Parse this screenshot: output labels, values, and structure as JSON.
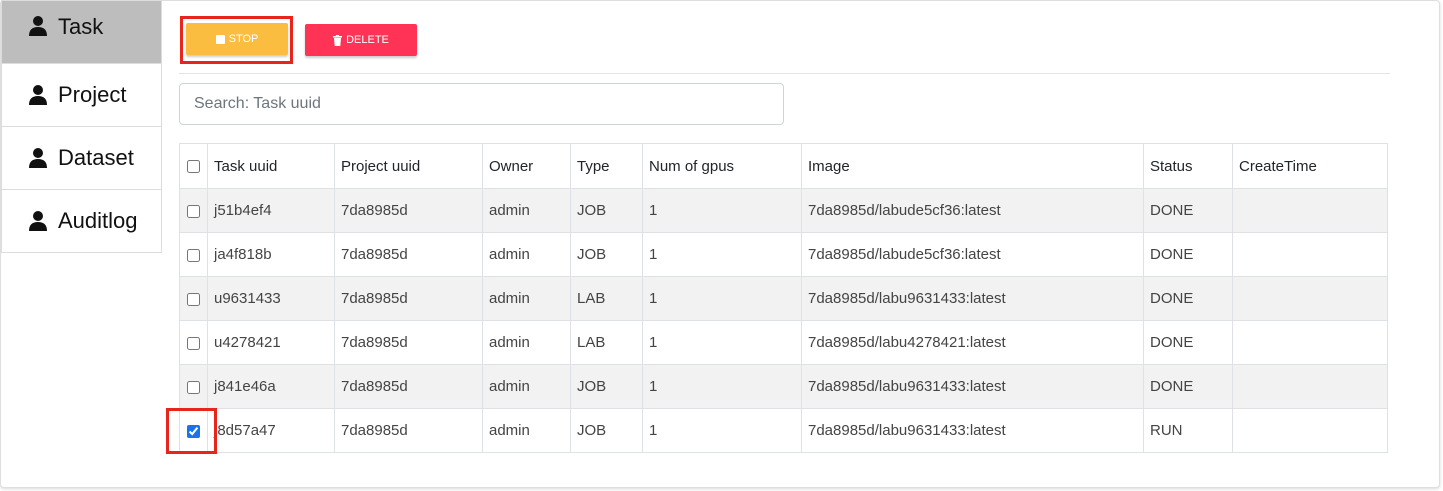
{
  "sidebar": {
    "items": [
      {
        "label": "Task",
        "icon": "user-icon",
        "active": true
      },
      {
        "label": "Project",
        "icon": "user-icon"
      },
      {
        "label": "Dataset",
        "icon": "user-icon"
      },
      {
        "label": "Auditlog",
        "icon": "user-icon"
      }
    ]
  },
  "toolbar": {
    "stop_label": "STOP",
    "delete_label": "DELETE",
    "stop_color": "#fbbd40",
    "delete_color": "#ff3355"
  },
  "search": {
    "placeholder": "Search: Task uuid",
    "value": ""
  },
  "table": {
    "headers": [
      "Task uuid",
      "Project uuid",
      "Owner",
      "Type",
      "Num of gpus",
      "Image",
      "Status",
      "CreateTime"
    ],
    "rows": [
      {
        "checked": false,
        "task_uuid": "j51b4ef4",
        "project_uuid": "7da8985d",
        "owner": "admin",
        "type": "JOB",
        "gpus": "1",
        "image": "7da8985d/labude5cf36:latest",
        "status": "DONE",
        "create_time": ""
      },
      {
        "checked": false,
        "task_uuid": "ja4f818b",
        "project_uuid": "7da8985d",
        "owner": "admin",
        "type": "JOB",
        "gpus": "1",
        "image": "7da8985d/labude5cf36:latest",
        "status": "DONE",
        "create_time": ""
      },
      {
        "checked": false,
        "task_uuid": "u9631433",
        "project_uuid": "7da8985d",
        "owner": "admin",
        "type": "LAB",
        "gpus": "1",
        "image": "7da8985d/labu9631433:latest",
        "status": "DONE",
        "create_time": ""
      },
      {
        "checked": false,
        "task_uuid": "u4278421",
        "project_uuid": "7da8985d",
        "owner": "admin",
        "type": "LAB",
        "gpus": "1",
        "image": "7da8985d/labu4278421:latest",
        "status": "DONE",
        "create_time": ""
      },
      {
        "checked": false,
        "task_uuid": "j841e46a",
        "project_uuid": "7da8985d",
        "owner": "admin",
        "type": "JOB",
        "gpus": "1",
        "image": "7da8985d/labu9631433:latest",
        "status": "DONE",
        "create_time": ""
      },
      {
        "checked": true,
        "task_uuid": "j8d57a47",
        "project_uuid": "7da8985d",
        "owner": "admin",
        "type": "JOB",
        "gpus": "1",
        "image": "7da8985d/labu9631433:latest",
        "status": "RUN",
        "create_time": ""
      }
    ]
  },
  "highlight_color": "#e8251c"
}
